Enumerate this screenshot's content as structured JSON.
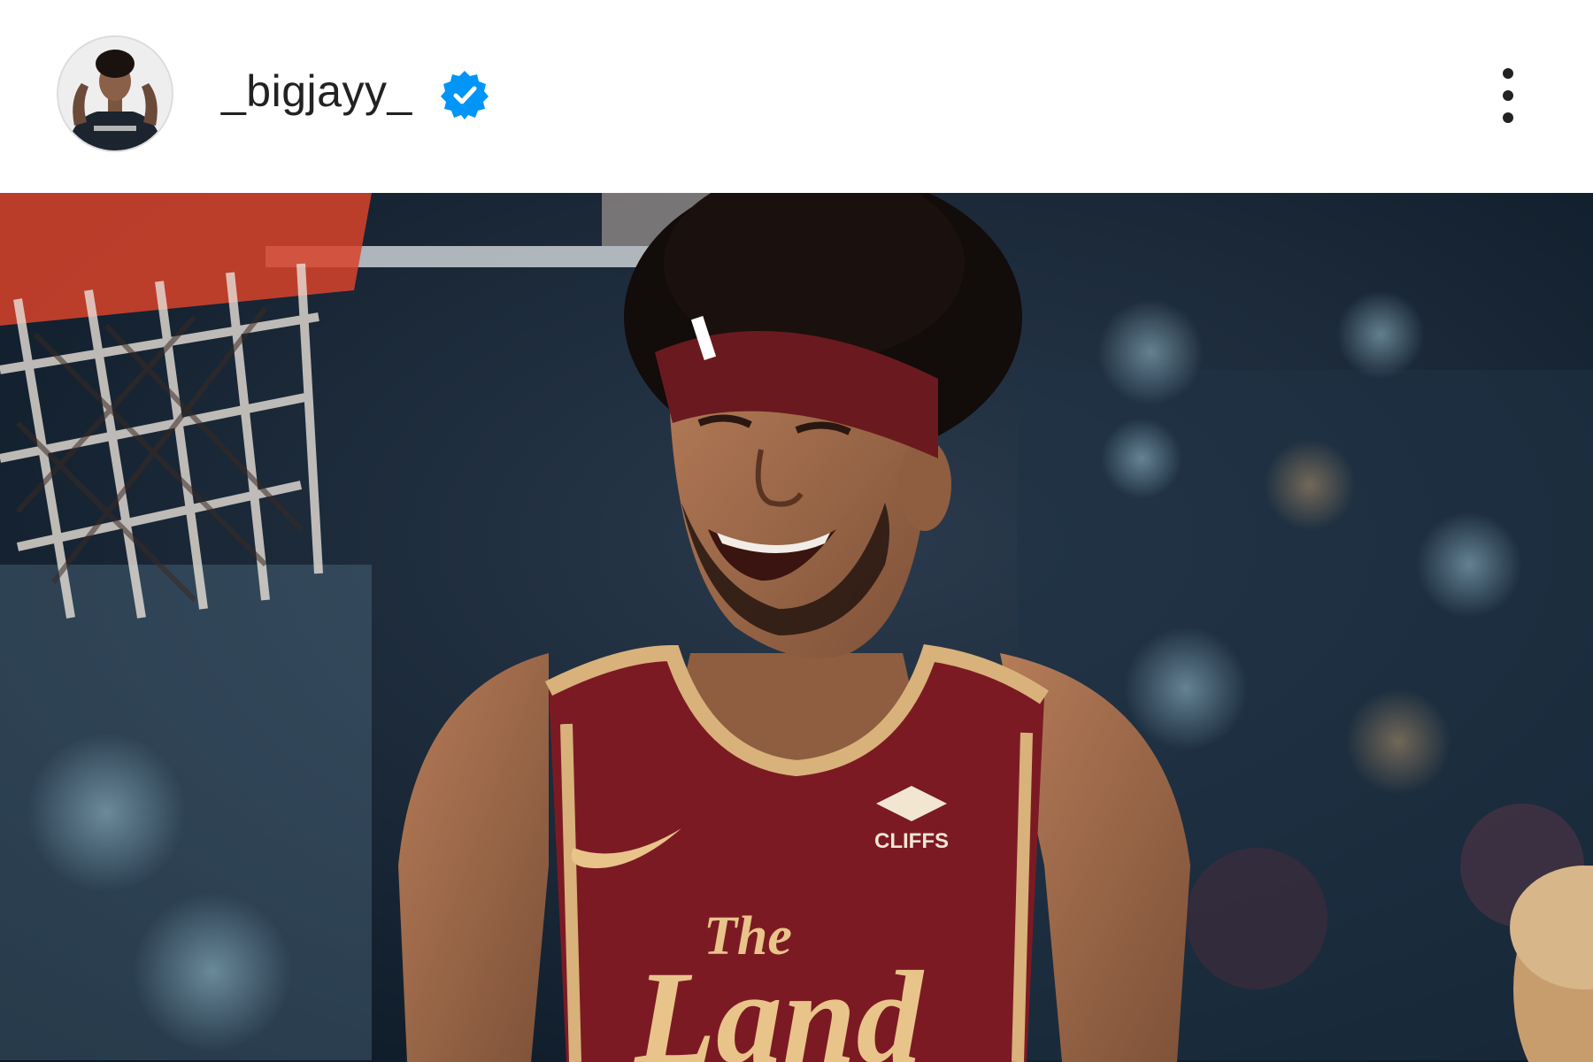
{
  "post_header": {
    "username": "_bigjayy_",
    "verified": true,
    "avatar_icon": "profile-photo",
    "more_icon": "three-dots-vertical-icon"
  },
  "post_image": {
    "jersey_brand": "CLIFFS",
    "jersey_line1": "The",
    "jersey_line2": "Land"
  },
  "colors": {
    "verified_blue": "#0095f6",
    "jersey_wine": "#7c1a24",
    "jersey_gold": "#e8c48a",
    "background": "#ffffff"
  }
}
